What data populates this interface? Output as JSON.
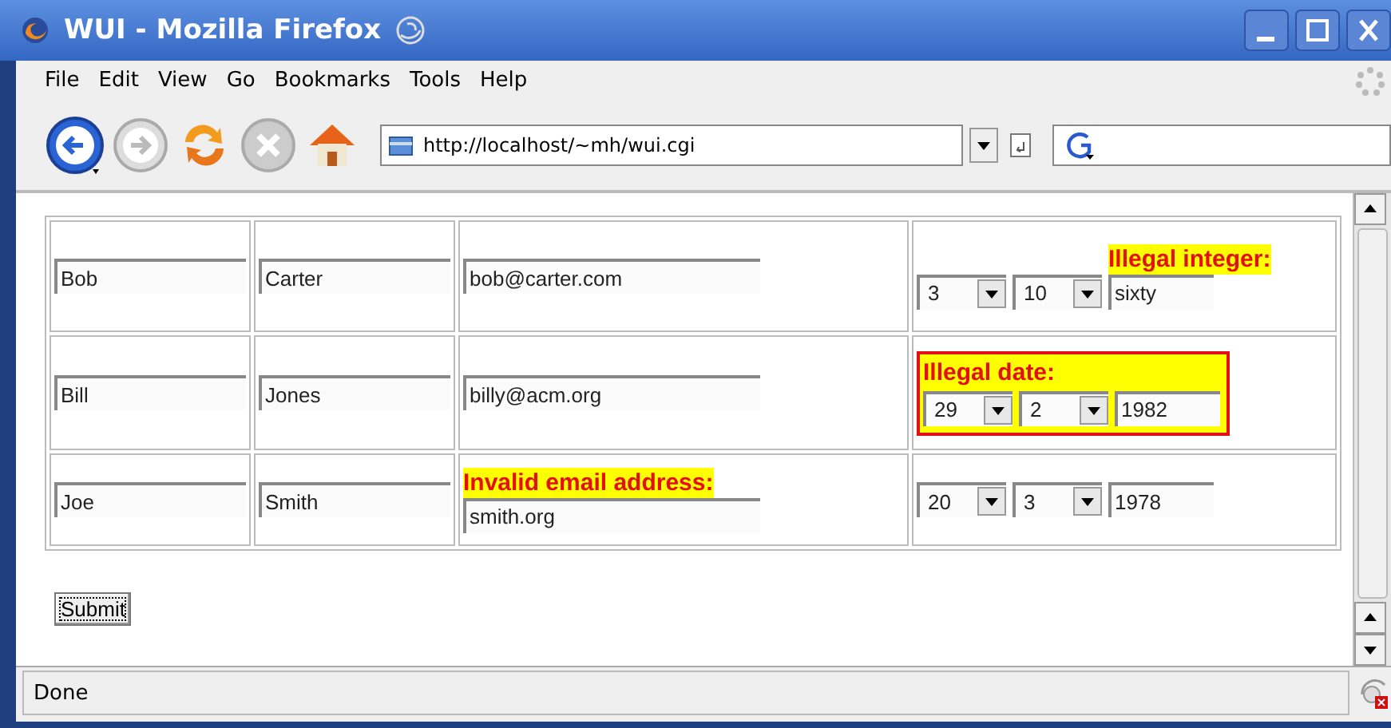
{
  "window": {
    "title": "WUI - Mozilla Firefox"
  },
  "menu": [
    "File",
    "Edit",
    "View",
    "Go",
    "Bookmarks",
    "Tools",
    "Help"
  ],
  "address": {
    "value": "http://localhost/~mh/wui.cgi"
  },
  "rows": [
    {
      "first": "Bob",
      "last": "Carter",
      "email": {
        "value": "bob@carter.com"
      },
      "day": "3",
      "month": "10",
      "year": "sixty",
      "date_error": {
        "text": "Illegal integer:",
        "kind": "field"
      }
    },
    {
      "first": "Bill",
      "last": "Jones",
      "email": {
        "value": "billy@acm.org"
      },
      "day": "29",
      "month": "2",
      "year": "1982",
      "date_error": {
        "text": "Illegal date:",
        "kind": "group"
      }
    },
    {
      "first": "Joe",
      "last": "Smith",
      "email": {
        "value": "smith.org",
        "error": "Invalid email address:"
      },
      "day": "20",
      "month": "3",
      "year": "1978"
    }
  ],
  "submit": "Submit",
  "status": "Done"
}
